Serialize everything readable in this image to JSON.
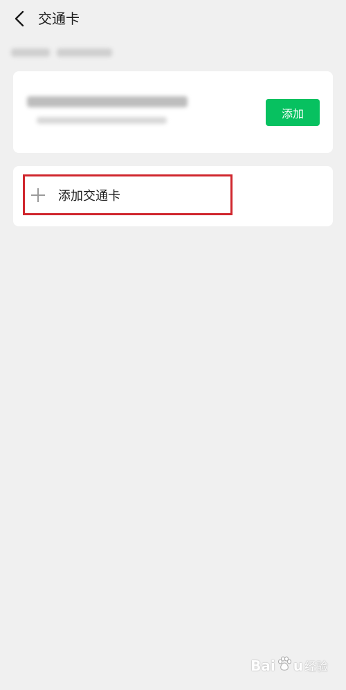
{
  "header": {
    "title": "交通卡"
  },
  "recommend_card": {
    "add_button_label": "添加"
  },
  "add_card": {
    "label": "添加交通卡"
  },
  "watermark": {
    "brand_left": "Bai",
    "brand_right": "u",
    "suffix": "经验"
  },
  "colors": {
    "accent_green": "#07c160",
    "highlight_red": "#d0262d",
    "background": "#f0f0f0"
  },
  "icons": {
    "back": "chevron-left-icon",
    "plus": "plus-icon",
    "paw": "paw-icon"
  }
}
